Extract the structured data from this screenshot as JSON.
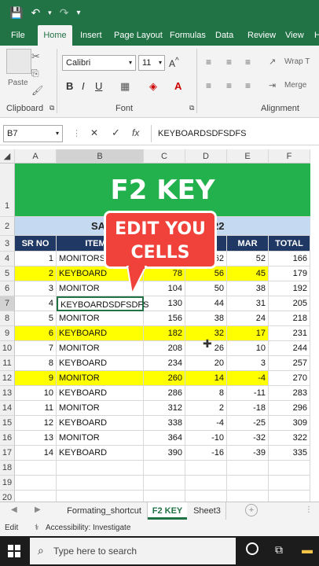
{
  "ribbon": {
    "tabs": [
      "File",
      "Home",
      "Insert",
      "Page Layout",
      "Formulas",
      "Data",
      "Review",
      "View",
      "H"
    ],
    "active_tab": "Home",
    "paste_label": "Paste",
    "font_name": "Calibri",
    "font_size": "11",
    "wrap_label": "Wrap T",
    "merge_label": "Merge",
    "clipboard_label": "Clipboard",
    "font_label": "Font",
    "alignment_label": "Alignment",
    "bold": "B",
    "italic": "I",
    "underline": "U"
  },
  "formula_bar": {
    "name_box": "B7",
    "cancel": "✕",
    "enter": "✓",
    "fx": "fx",
    "content": "KEYBOARDSDFSDFS"
  },
  "columns": [
    "A",
    "B",
    "C",
    "D",
    "E",
    "F"
  ],
  "rows": [
    "1",
    "2",
    "3",
    "4",
    "5",
    "6",
    "7",
    "8",
    "9",
    "10",
    "11",
    "12",
    "13",
    "14",
    "15",
    "16",
    "17",
    "18",
    "19",
    "20"
  ],
  "sheet": {
    "banner": "F2 KEY",
    "subtitle_left": "SA",
    "subtitle_right": "22",
    "headers": [
      "SR NO",
      "ITEM N",
      "",
      "",
      "MAR",
      "TOTAL"
    ],
    "data": [
      [
        "1",
        "MONITORS",
        "",
        "62",
        "52",
        "166"
      ],
      [
        "2",
        "KEYBOARD",
        "78",
        "56",
        "45",
        "179"
      ],
      [
        "3",
        "MONITOR",
        "104",
        "50",
        "38",
        "192"
      ],
      [
        "4",
        "KEYBOARDSDFSDFS",
        "130",
        "44",
        "31",
        "205"
      ],
      [
        "5",
        "MONITOR",
        "156",
        "38",
        "24",
        "218"
      ],
      [
        "6",
        "KEYBOARD",
        "182",
        "32",
        "17",
        "231"
      ],
      [
        "7",
        "MONITOR",
        "208",
        "26",
        "10",
        "244"
      ],
      [
        "8",
        "KEYBOARD",
        "234",
        "20",
        "3",
        "257"
      ],
      [
        "9",
        "MONITOR",
        "260",
        "14",
        "-4",
        "270"
      ],
      [
        "10",
        "KEYBOARD",
        "286",
        "8",
        "-11",
        "283"
      ],
      [
        "11",
        "MONITOR",
        "312",
        "2",
        "-18",
        "296"
      ],
      [
        "12",
        "KEYBOARD",
        "338",
        "-4",
        "-25",
        "309"
      ],
      [
        "13",
        "MONITOR",
        "364",
        "-10",
        "-32",
        "322"
      ],
      [
        "14",
        "KEYBOARD",
        "390",
        "-16",
        "-39",
        "335"
      ]
    ]
  },
  "callout": {
    "line1": "EDIT YOU",
    "line2": "CELLS"
  },
  "sheet_tabs": [
    "Formating_shortcut",
    "F2 KEY",
    "Sheet3"
  ],
  "status": {
    "mode": "Edit",
    "accessibility": "Accessibility: Investigate"
  },
  "taskbar": {
    "search_placeholder": "Type here to search"
  },
  "colors": {
    "green": "#217346",
    "banner": "#22b14c",
    "header_blue": "#1f3864",
    "light_blue": "#c5d9f1",
    "yellow": "#ffff00",
    "callout": "#f0423b"
  }
}
